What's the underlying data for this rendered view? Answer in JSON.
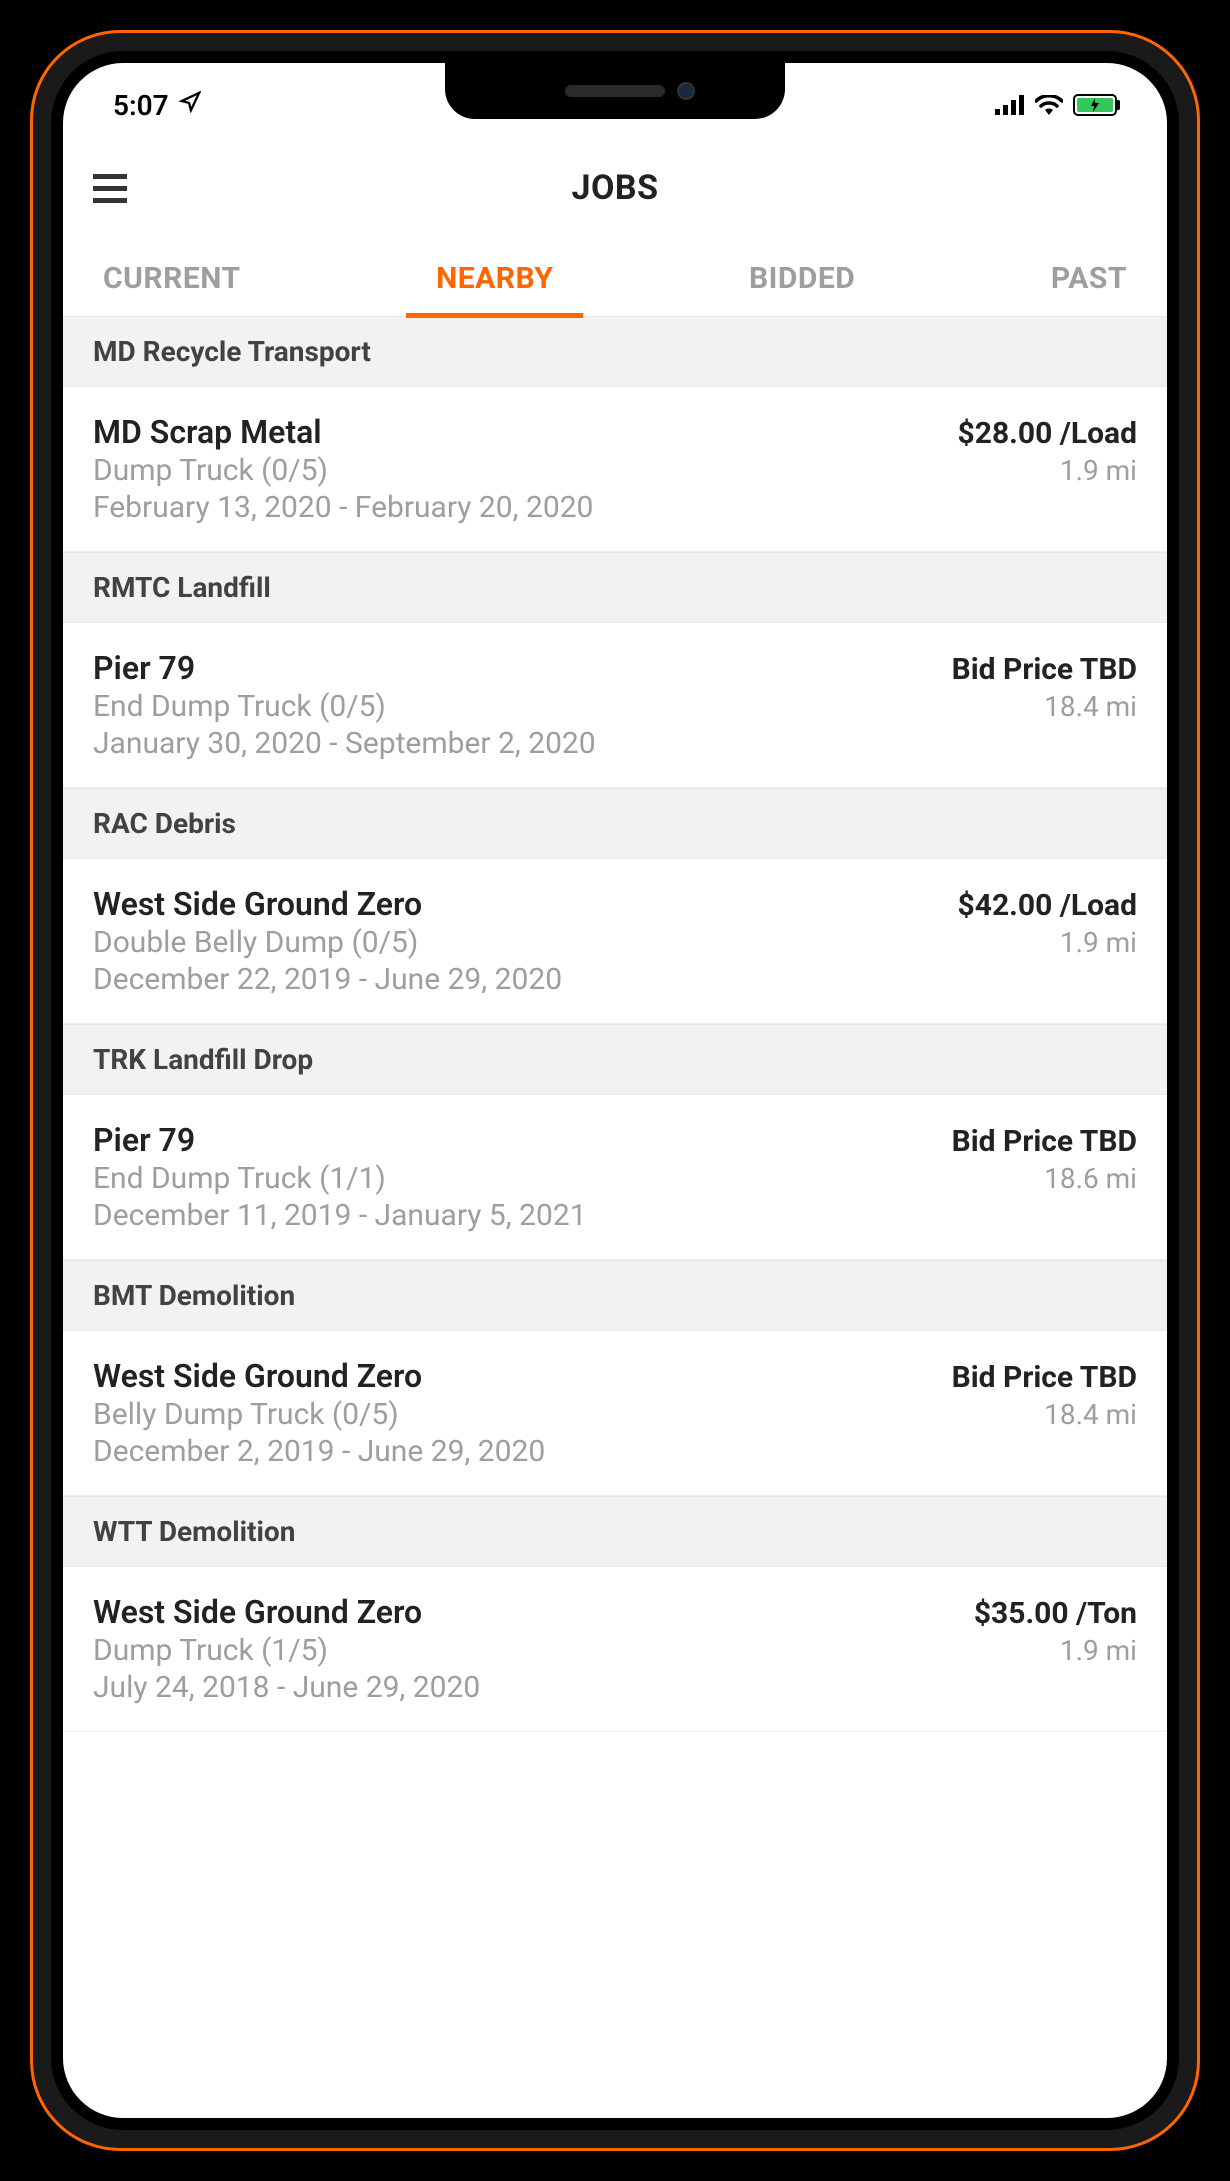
{
  "status": {
    "time": "5:07",
    "location_active": true
  },
  "nav": {
    "title": "JOBS"
  },
  "tabs": [
    {
      "label": "CURRENT",
      "active": false
    },
    {
      "label": "NEARBY",
      "active": true
    },
    {
      "label": "BIDDED",
      "active": false
    },
    {
      "label": "PAST",
      "active": false
    }
  ],
  "sections": [
    {
      "header": "MD Recycle Transport",
      "jobs": [
        {
          "title": "MD Scrap Metal",
          "price": "$28.00 /Load",
          "vehicle": "Dump Truck (0/5)",
          "distance": "1.9 mi",
          "dates": "February 13, 2020 - February 20, 2020"
        }
      ]
    },
    {
      "header": "RMTC Landfill",
      "jobs": [
        {
          "title": "Pier 79",
          "price": "Bid Price TBD",
          "vehicle": "End Dump Truck (0/5)",
          "distance": "18.4 mi",
          "dates": "January 30, 2020 - September 2, 2020"
        }
      ]
    },
    {
      "header": "RAC Debris",
      "jobs": [
        {
          "title": "West Side Ground Zero",
          "price": "$42.00 /Load",
          "vehicle": "Double Belly Dump (0/5)",
          "distance": "1.9 mi",
          "dates": "December 22, 2019 - June 29, 2020"
        }
      ]
    },
    {
      "header": "TRK Landfill Drop",
      "jobs": [
        {
          "title": "Pier 79",
          "price": "Bid Price TBD",
          "vehicle": "End Dump Truck (1/1)",
          "distance": "18.6 mi",
          "dates": "December 11, 2019 - January 5, 2021"
        }
      ]
    },
    {
      "header": "BMT Demolition",
      "jobs": [
        {
          "title": "West Side Ground Zero",
          "price": "Bid Price TBD",
          "vehicle": "Belly Dump Truck (0/5)",
          "distance": "18.4 mi",
          "dates": "December 2, 2019 - June 29, 2020"
        }
      ]
    },
    {
      "header": "WTT Demolition",
      "jobs": [
        {
          "title": "West Side Ground Zero",
          "price": "$35.00 /Ton",
          "vehicle": "Dump Truck (1/5)",
          "distance": "1.9 mi",
          "dates": "July 24, 2018 - June 29, 2020"
        }
      ]
    }
  ]
}
